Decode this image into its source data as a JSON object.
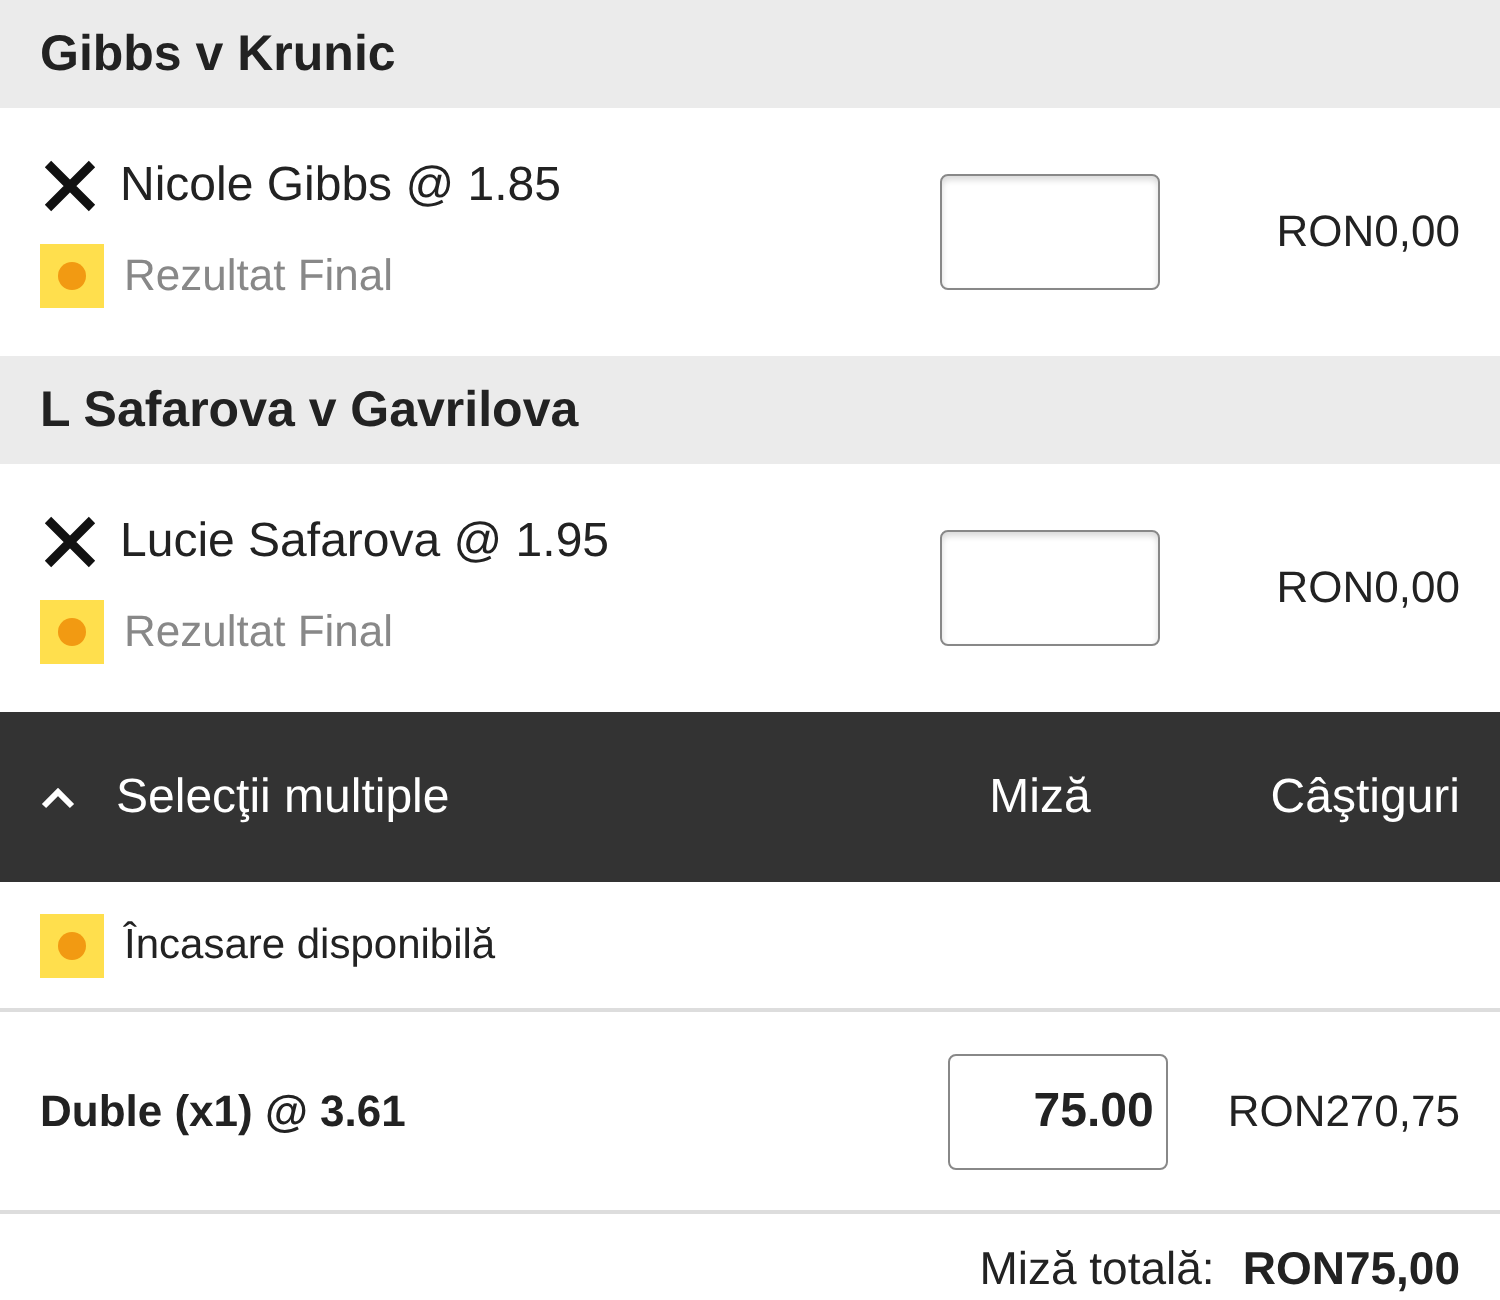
{
  "selections": [
    {
      "event": "Gibbs v Krunic",
      "pick": "Nicole Gibbs @ 1.85",
      "market": "Rezultat Final",
      "returns": "RON0,00"
    },
    {
      "event": "L Safarova v Gavrilova",
      "pick": "Lucie Safarova @ 1.95",
      "market": "Rezultat Final",
      "returns": "RON0,00"
    }
  ],
  "multiples": {
    "title": "Selecţii multiple",
    "expanded": true,
    "stake_heading": "Miză",
    "returns_heading": "Câştiguri",
    "cashout": "Încasare disponibilă",
    "bets": [
      {
        "label": "Duble (x1) @ 3.61",
        "stake": "75.00",
        "returns": "RON270,75"
      }
    ]
  },
  "total": {
    "label": "Miză totală:",
    "value": "RON75,00"
  }
}
